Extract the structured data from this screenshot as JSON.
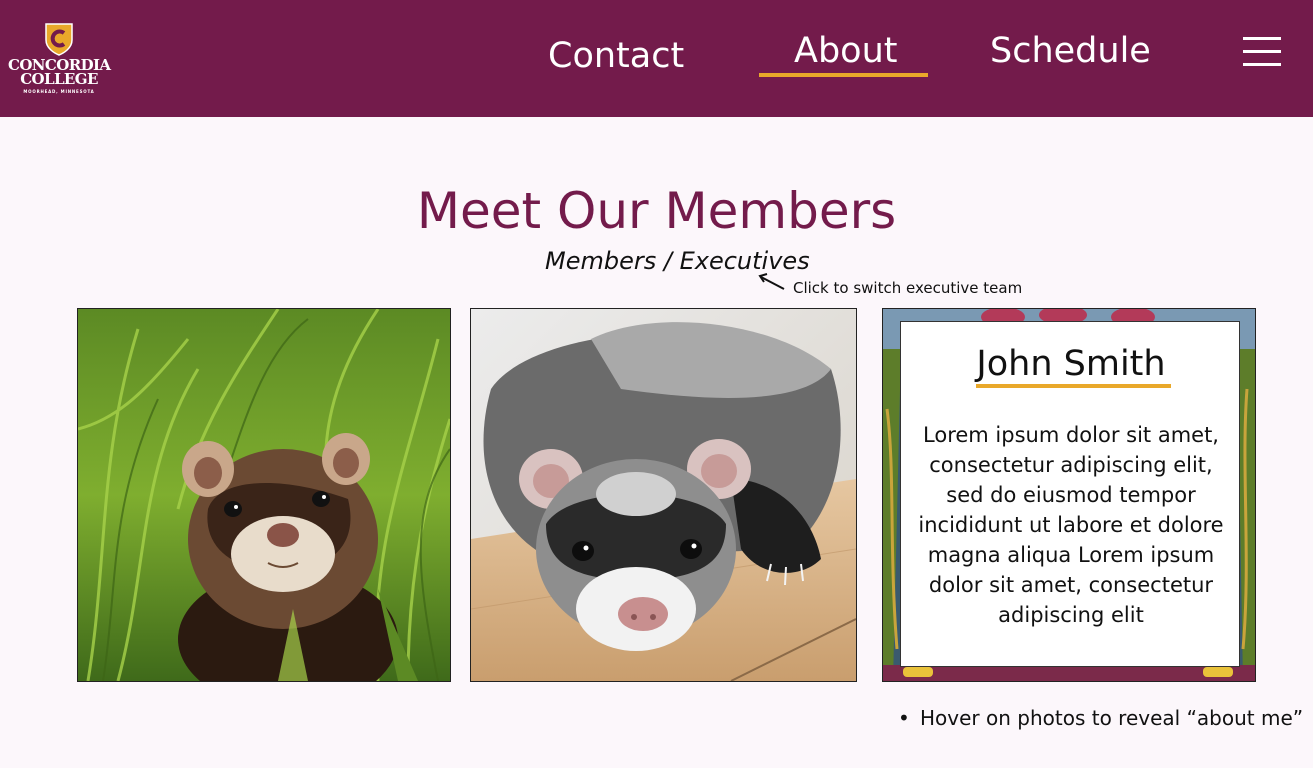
{
  "header": {
    "logo": {
      "line1": "CONCORDIA",
      "line2": "COLLEGE",
      "tagline": "MOORHEAD, MINNESOTA",
      "mark": "C"
    },
    "nav": [
      {
        "label": "Contact",
        "active": false
      },
      {
        "label": "About",
        "active": true
      },
      {
        "label": "Schedule",
        "active": false
      }
    ],
    "menu_icon": "hamburger-icon"
  },
  "main": {
    "title": "Meet Our Members",
    "switcher": {
      "members": "Members",
      "separator": " / ",
      "executives": "Executives"
    },
    "hint": "Click to switch executive team",
    "cards": [
      {
        "image": "ferret-in-grass-photo"
      },
      {
        "image": "ferret-lying-on-floor-photo"
      },
      {
        "image": "cornfield-background-photo",
        "name": "John Smith",
        "bio": "Lorem ipsum dolor sit amet, consectetur adipiscing elit, sed do eiusmod tempor incididunt ut labore et dolore magna aliqua Lorem ipsum dolor sit amet, consectetur adipiscing elit"
      }
    ],
    "note": "Hover on photos to reveal “about me”"
  },
  "colors": {
    "brand": "#731b4b",
    "accent": "#e9a82a",
    "background": "#fcf7fb"
  }
}
